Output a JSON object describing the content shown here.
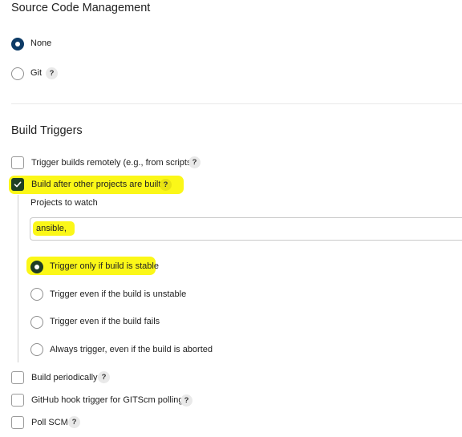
{
  "scm": {
    "title": "Source Code Management",
    "options": [
      {
        "label": "None",
        "selected": true
      },
      {
        "label": "Git",
        "selected": false,
        "help": "?"
      }
    ]
  },
  "triggers": {
    "title": "Build Triggers",
    "remote": {
      "label": "Trigger builds remotely (e.g., from scripts)",
      "checked": false,
      "help": "?"
    },
    "after_other": {
      "label": "Build after other projects are built",
      "checked": true,
      "help": "?",
      "projects_label": "Projects to watch",
      "projects_value": "ansible,",
      "options": [
        {
          "label": "Trigger only if build is stable",
          "selected": true
        },
        {
          "label": "Trigger even if the build is unstable",
          "selected": false
        },
        {
          "label": "Trigger even if the build fails",
          "selected": false
        },
        {
          "label": "Always trigger, even if the build is aborted",
          "selected": false
        }
      ]
    },
    "periodic": {
      "label": "Build periodically",
      "checked": false,
      "help": "?"
    },
    "github_hook": {
      "label": "GitHub hook trigger for GITScm polling",
      "checked": false,
      "help": "?"
    },
    "poll_scm": {
      "label": "Poll SCM",
      "checked": false,
      "help": "?"
    }
  },
  "colors": {
    "accent": "#0d3b66",
    "checked": "#1e4023",
    "highlight": "#fbf718"
  }
}
